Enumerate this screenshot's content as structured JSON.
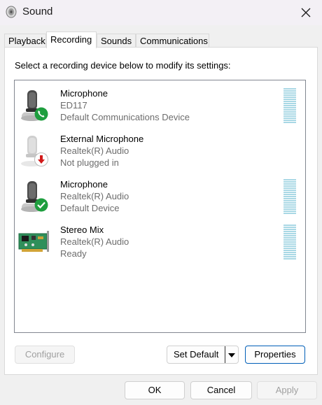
{
  "window": {
    "title": "Sound"
  },
  "tabs": [
    {
      "label": "Playback",
      "active": false
    },
    {
      "label": "Recording",
      "active": true
    },
    {
      "label": "Sounds",
      "active": false
    },
    {
      "label": "Communications",
      "active": false
    }
  ],
  "instruction": "Select a recording device below to modify its settings:",
  "devices": [
    {
      "name": "Microphone",
      "line2": "ED117",
      "line3": "Default Communications Device",
      "icon": "microphone-icon",
      "badge": "phone-badge-icon",
      "level_meter": true
    },
    {
      "name": "External Microphone",
      "line2": "Realtek(R) Audio",
      "line3": "Not plugged in",
      "icon": "microphone-icon",
      "badge": "unplugged-badge-icon",
      "level_meter": false
    },
    {
      "name": "Microphone",
      "line2": "Realtek(R) Audio",
      "line3": "Default Device",
      "icon": "microphone-icon",
      "badge": "default-check-badge-icon",
      "level_meter": true
    },
    {
      "name": "Stereo Mix",
      "line2": "Realtek(R) Audio",
      "line3": "Ready",
      "icon": "sound-card-icon",
      "badge": "",
      "level_meter": true
    }
  ],
  "buttons": {
    "configure": "Configure",
    "set_default": "Set Default",
    "properties": "Properties",
    "ok": "OK",
    "cancel": "Cancel",
    "apply": "Apply"
  },
  "colors": {
    "accent": "#005fb8",
    "level_meter": "#a9d8e5",
    "badge_green": "#1e9e3e",
    "badge_red": "#d11a1a"
  }
}
